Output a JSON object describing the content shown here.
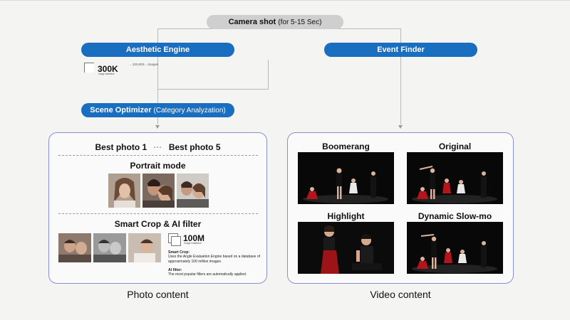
{
  "camera_shot": {
    "title": "Camera shot",
    "detail": "(for 5-15 Sec)"
  },
  "aesthetic_engine": {
    "label": "Aesthetic Engine",
    "stat_value": "300K",
    "stat_caption": "image database",
    "description": "...100,000... images"
  },
  "event_finder": {
    "label": "Event Finder"
  },
  "scene_optimizer": {
    "label": "Scene Optimizer",
    "detail": "(Category Analyzation)"
  },
  "photo_panel": {
    "best_first": "Best photo 1",
    "dots": "···",
    "best_last": "Best photo 5",
    "portrait_title": "Portrait mode",
    "crop_title": "Smart Crop & AI filter",
    "stat_value": "100M",
    "stat_caption": "Image Database",
    "smart_crop_heading": "Smart Crop:",
    "smart_crop_text": "Uses the Angle Evaluation Engine based on a database of approximately 100 million images.",
    "ai_filter_heading": "AI filter:",
    "ai_filter_text": "The most popular filters are automatically applied."
  },
  "video_panel": {
    "boomerang": "Boomerang",
    "original": "Original",
    "highlight": "Highlight",
    "slowmo": "Dynamic Slow-mo"
  },
  "captions": {
    "photo": "Photo content",
    "video": "Video content"
  },
  "colors": {
    "accent": "#1a6ec0",
    "panel_border": "#8a8fd2",
    "pill_grey": "#cfcfcf"
  }
}
